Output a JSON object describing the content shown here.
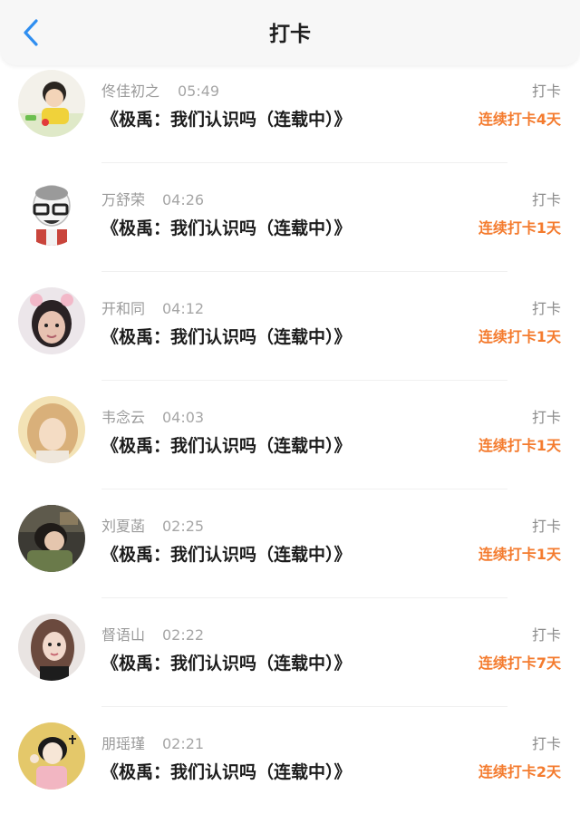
{
  "header": {
    "title": "打卡",
    "back_icon": "chevron-left-icon",
    "accent_color": "#2f8ef0"
  },
  "colors": {
    "streak": "#f47b2e",
    "name": "#9a9a9a"
  },
  "entries": [
    {
      "name": "佟佳初之",
      "time": "05:49",
      "book": "《极禹：我们认识吗（连载中）》",
      "action": "打卡",
      "streak": "连续打卡4天"
    },
    {
      "name": "万舒荣",
      "time": "04:26",
      "book": "《极禹：我们认识吗（连载中）》",
      "action": "打卡",
      "streak": "连续打卡1天"
    },
    {
      "name": "开和同",
      "time": "04:12",
      "book": "《极禹：我们认识吗（连载中）》",
      "action": "打卡",
      "streak": "连续打卡1天"
    },
    {
      "name": "韦念云",
      "time": "04:03",
      "book": "《极禹：我们认识吗（连载中）》",
      "action": "打卡",
      "streak": "连续打卡1天"
    },
    {
      "name": "刘夏菡",
      "time": "02:25",
      "book": "《极禹：我们认识吗（连载中）》",
      "action": "打卡",
      "streak": "连续打卡1天"
    },
    {
      "name": "督语山",
      "time": "02:22",
      "book": "《极禹：我们认识吗（连载中）》",
      "action": "打卡",
      "streak": "连续打卡7天"
    },
    {
      "name": "朋瑶瑾",
      "time": "02:21",
      "book": "《极禹：我们认识吗（连载中）》",
      "action": "打卡",
      "streak": "连续打卡2天"
    }
  ]
}
